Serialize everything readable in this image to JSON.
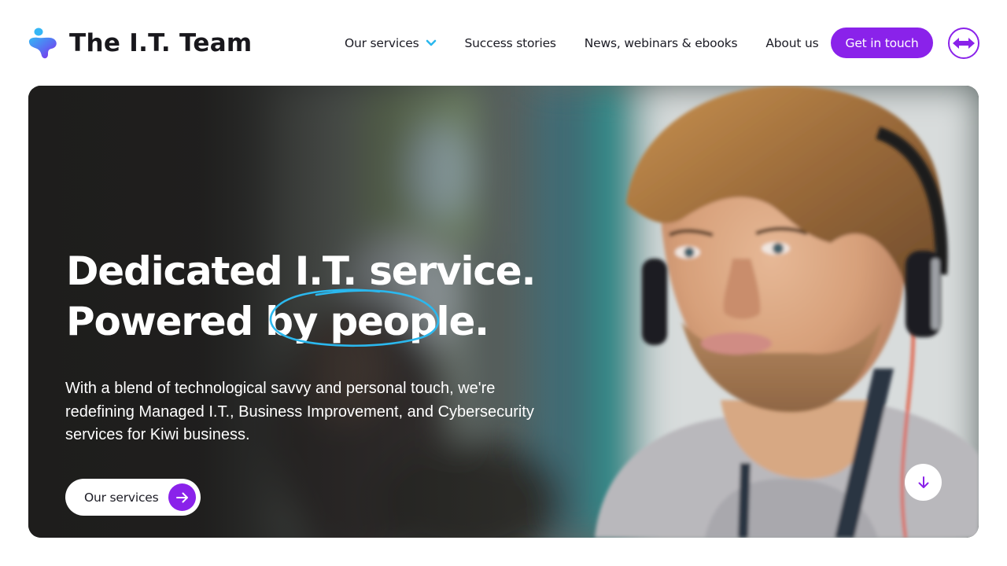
{
  "brand": {
    "name": "The I.T. Team",
    "accent_color": "#8a22ea",
    "highlight_color": "#2bb8ee"
  },
  "nav": {
    "items": [
      {
        "label": "Our services",
        "has_dropdown": true
      },
      {
        "label": "Success stories"
      },
      {
        "label": "News, webinars & ebooks"
      },
      {
        "label": "About us"
      }
    ],
    "cta_label": "Get in touch",
    "remote_support_icon": "teamviewer-arrows-icon"
  },
  "hero": {
    "title_line1_a": "Dedicated I.T. ",
    "title_line1_b": "service.",
    "title_line2_a": "Powered by ",
    "title_line2_b": "people.",
    "subtitle": "With a blend of technological savvy and personal touch, we're redefining Managed I.T., Business Improvement, and Cybersecurity services for Kiwi business.",
    "primary_button_label": "Our services",
    "primary_button_icon": "arrow-right-icon",
    "scroll_icon": "arrow-down-icon",
    "image_description": "Man with headphones looking at screen in office"
  }
}
